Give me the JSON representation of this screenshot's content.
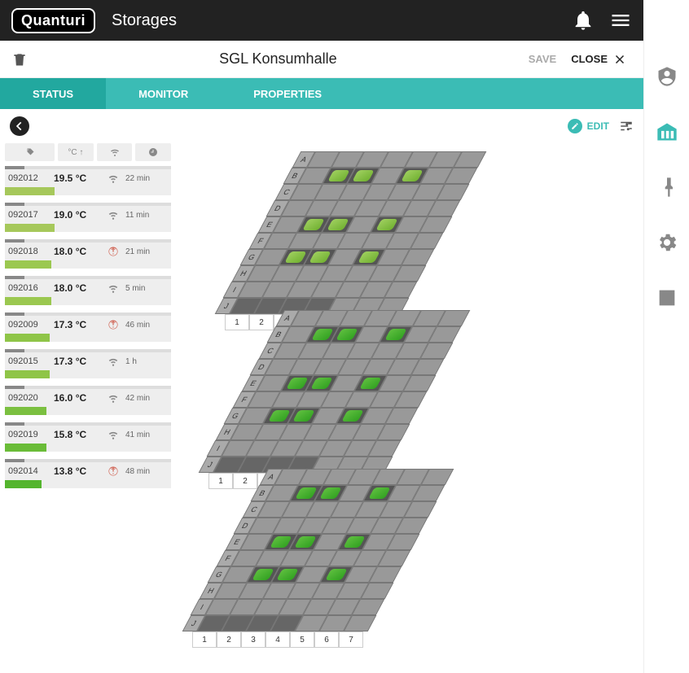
{
  "brand": "Quanturi",
  "top_title": "Storages",
  "page_title": "SGL Konsumhalle",
  "save_label": "SAVE",
  "close_label": "CLOSE",
  "tabs": [
    {
      "label": "STATUS",
      "active": true
    },
    {
      "label": "MONITOR",
      "active": false
    },
    {
      "label": "PROPERTIES",
      "active": false
    }
  ],
  "edit_label": "EDIT",
  "filter_temp_label": "°C ↑",
  "sensors": [
    {
      "id": "092012",
      "temp": "19.5 °C",
      "time": "22 min",
      "signal": "wifi",
      "fill": 30,
      "color": "#a6c85b"
    },
    {
      "id": "092017",
      "temp": "19.0 °C",
      "time": "11 min",
      "signal": "wifi",
      "fill": 30,
      "color": "#a6c85b"
    },
    {
      "id": "092018",
      "temp": "18.0 °C",
      "time": "21 min",
      "signal": "alert",
      "fill": 28,
      "color": "#9bc850"
    },
    {
      "id": "092016",
      "temp": "18.0 °C",
      "time": "5 min",
      "signal": "wifi",
      "fill": 28,
      "color": "#9bc850"
    },
    {
      "id": "092009",
      "temp": "17.3 °C",
      "time": "46 min",
      "signal": "alert",
      "fill": 27,
      "color": "#8fc548"
    },
    {
      "id": "092015",
      "temp": "17.3 °C",
      "time": "1 h",
      "signal": "wifi",
      "fill": 27,
      "color": "#8fc548"
    },
    {
      "id": "092020",
      "temp": "16.0 °C",
      "time": "42 min",
      "signal": "wifi",
      "fill": 25,
      "color": "#7bc040"
    },
    {
      "id": "092019",
      "temp": "15.8 °C",
      "time": "41 min",
      "signal": "wifi",
      "fill": 25,
      "color": "#6abc38"
    },
    {
      "id": "092014",
      "temp": "13.8 °C",
      "time": "48 min",
      "signal": "alert",
      "fill": 22,
      "color": "#54b52e"
    }
  ],
  "grid": {
    "row_labels": [
      "A",
      "B",
      "C",
      "D",
      "E",
      "F",
      "G",
      "H",
      "I",
      "J"
    ],
    "col_labels": [
      "1",
      "2",
      "3",
      "4",
      "5",
      "6",
      "7"
    ],
    "layers": 3,
    "sensor_cells": [
      {
        "r": "B",
        "c": 2
      },
      {
        "r": "B",
        "c": 3
      },
      {
        "r": "B",
        "c": 5
      },
      {
        "r": "E",
        "c": 2
      },
      {
        "r": "E",
        "c": 3
      },
      {
        "r": "E",
        "c": 5
      },
      {
        "r": "G",
        "c": 2
      },
      {
        "r": "G",
        "c": 3
      },
      {
        "r": "G",
        "c": 5
      }
    ]
  }
}
